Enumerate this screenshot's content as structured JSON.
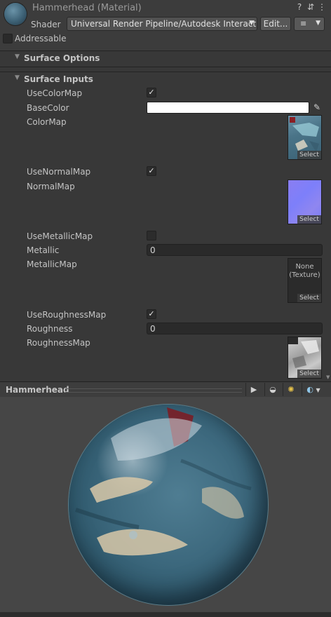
{
  "header": {
    "title": "Hammerhead (Material)",
    "shader_label": "Shader",
    "shader_value": "Universal Render Pipeline/Autodesk Interactiv",
    "edit_label": "Edit...",
    "list_icon": "≡",
    "help_icon": "?",
    "settings_icon": "⇵",
    "more_icon": "⋮",
    "addressable_label": "Addressable"
  },
  "sections": {
    "surface_options": "Surface Options",
    "surface_inputs": "Surface Inputs"
  },
  "properties": {
    "use_color_map": "UseColorMap",
    "base_color": "BaseColor",
    "color_map": "ColorMap",
    "use_normal_map": "UseNormalMap",
    "normal_map": "NormalMap",
    "use_metallic_map": "UseMetallicMap",
    "metallic": "Metallic",
    "metallic_value": "0",
    "metallic_map": "MetallicMap",
    "use_roughness_map": "UseRoughnessMap",
    "roughness": "Roughness",
    "roughness_value": "0",
    "roughness_map": "RoughnessMap",
    "checked": "✓",
    "select": "Select",
    "none_texture_line1": "None",
    "none_texture_line2": "(Texture)",
    "base_color_hex": "#ffffff"
  },
  "preview": {
    "title": "Hammerhead",
    "play_icon": "▶",
    "sphere_icon": "◒",
    "lights_icon": "✺",
    "bg_icon": "◐"
  }
}
